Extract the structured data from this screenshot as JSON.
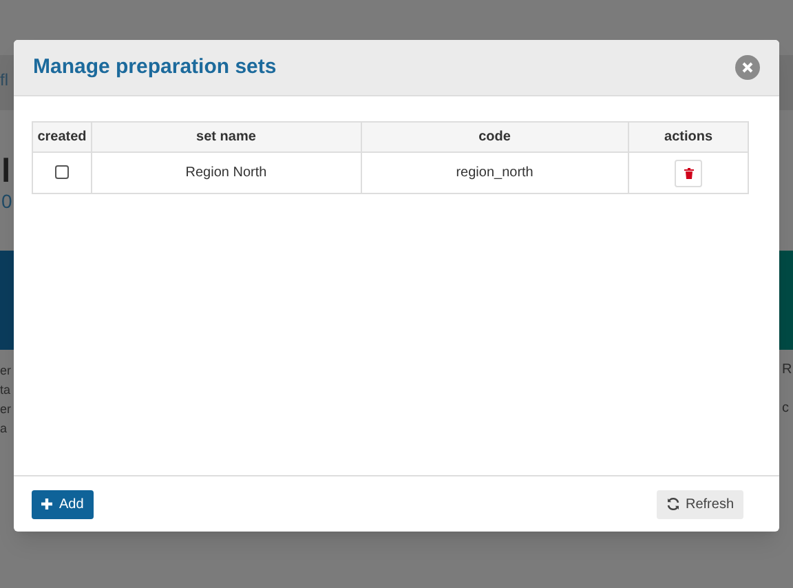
{
  "background": {
    "breadcrumb": "fl",
    "heading": "l",
    "subheading": "0",
    "left_card_lines": [
      "er",
      "ta",
      "er",
      "a"
    ],
    "right_card_lines": [
      "R",
      "c"
    ]
  },
  "modal": {
    "title": "Manage preparation sets",
    "columns": [
      "created",
      "set name",
      "code",
      "actions"
    ],
    "rows": [
      {
        "checked": false,
        "set_name": "Region North",
        "code": "region_north"
      }
    ],
    "footer": {
      "add_label": "Add",
      "refresh_label": "Refresh"
    }
  }
}
